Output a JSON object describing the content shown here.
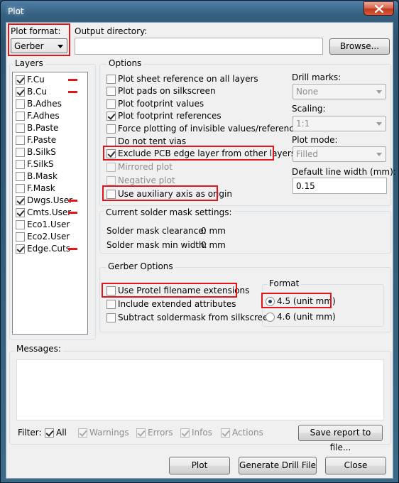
{
  "window": {
    "title": "Plot"
  },
  "plot_format": {
    "label": "Plot format:",
    "value": "Gerber"
  },
  "output_directory": {
    "label": "Output directory:",
    "value": "",
    "browse_label": "Browse..."
  },
  "layers": {
    "title": "Layers",
    "items": [
      {
        "name": "F.Cu",
        "checked": true,
        "marked": true
      },
      {
        "name": "B.Cu",
        "checked": true,
        "marked": true
      },
      {
        "name": "B.Adhes",
        "checked": false,
        "marked": false
      },
      {
        "name": "F.Adhes",
        "checked": false,
        "marked": false
      },
      {
        "name": "B.Paste",
        "checked": false,
        "marked": false
      },
      {
        "name": "F.Paste",
        "checked": false,
        "marked": false
      },
      {
        "name": "B.SilkS",
        "checked": false,
        "marked": false
      },
      {
        "name": "F.SilkS",
        "checked": false,
        "marked": false
      },
      {
        "name": "B.Mask",
        "checked": false,
        "marked": false
      },
      {
        "name": "F.Mask",
        "checked": false,
        "marked": false
      },
      {
        "name": "Dwgs.User",
        "checked": true,
        "marked": true
      },
      {
        "name": "Cmts.User",
        "checked": true,
        "marked": true
      },
      {
        "name": "Eco1.User",
        "checked": false,
        "marked": false
      },
      {
        "name": "Eco2.User",
        "checked": false,
        "marked": false
      },
      {
        "name": "Edge.Cuts",
        "checked": true,
        "marked": true
      }
    ]
  },
  "options": {
    "title": "Options",
    "items": [
      {
        "label": "Plot sheet reference on all layers",
        "checked": false,
        "disabled": false
      },
      {
        "label": "Plot pads on silkscreen",
        "checked": false,
        "disabled": false
      },
      {
        "label": "Plot footprint values",
        "checked": false,
        "disabled": false
      },
      {
        "label": "Plot footprint references",
        "checked": true,
        "disabled": false
      },
      {
        "label": "Force plotting of invisible values/references",
        "checked": false,
        "disabled": false
      },
      {
        "label": "Do not tent vias",
        "checked": false,
        "disabled": false
      },
      {
        "label": "Exclude PCB edge layer from other layers",
        "checked": true,
        "disabled": false
      },
      {
        "label": "Mirrored plot",
        "checked": false,
        "disabled": true
      },
      {
        "label": "Negative plot",
        "checked": false,
        "disabled": true
      },
      {
        "label": "Use auxiliary axis as origin",
        "checked": false,
        "disabled": false
      }
    ],
    "drill_marks": {
      "label": "Drill marks:",
      "value": "None"
    },
    "scaling": {
      "label": "Scaling:",
      "value": "1:1"
    },
    "plot_mode": {
      "label": "Plot mode:",
      "value": "Filled"
    },
    "default_line_width": {
      "label": "Default line width (mm):",
      "value": "0.15"
    }
  },
  "solder_mask": {
    "title": "Current solder mask settings:",
    "clearance_label": "Solder mask clearance:",
    "clearance_value": "0 mm",
    "min_width_label": "Solder mask min width:",
    "min_width_value": "0 mm"
  },
  "gerber_options": {
    "title": "Gerber Options",
    "items": [
      {
        "label": "Use Protel filename extensions",
        "checked": false
      },
      {
        "label": "Include extended attributes",
        "checked": false
      },
      {
        "label": "Subtract soldermask from silkscreen",
        "checked": false
      }
    ],
    "format": {
      "title": "Format",
      "options": [
        {
          "label": "4.5 (unit mm)",
          "selected": true
        },
        {
          "label": "4.6 (unit mm)",
          "selected": false
        }
      ]
    }
  },
  "messages": {
    "title": "Messages:",
    "filter_label": "Filter:",
    "filters": [
      {
        "label": "All",
        "checked": true,
        "disabled": false
      },
      {
        "label": "Warnings",
        "checked": true,
        "disabled": true
      },
      {
        "label": "Errors",
        "checked": true,
        "disabled": true
      },
      {
        "label": "Infos",
        "checked": true,
        "disabled": true
      },
      {
        "label": "Actions",
        "checked": true,
        "disabled": true
      }
    ],
    "save_report_label": "Save report to file..."
  },
  "footer": {
    "plot_label": "Plot",
    "drill_label": "Generate Drill File",
    "close_label": "Close"
  },
  "colors": {
    "highlight": "#e0161d",
    "title_bg": "#35607f",
    "client_bg": "#f0f0f0"
  }
}
